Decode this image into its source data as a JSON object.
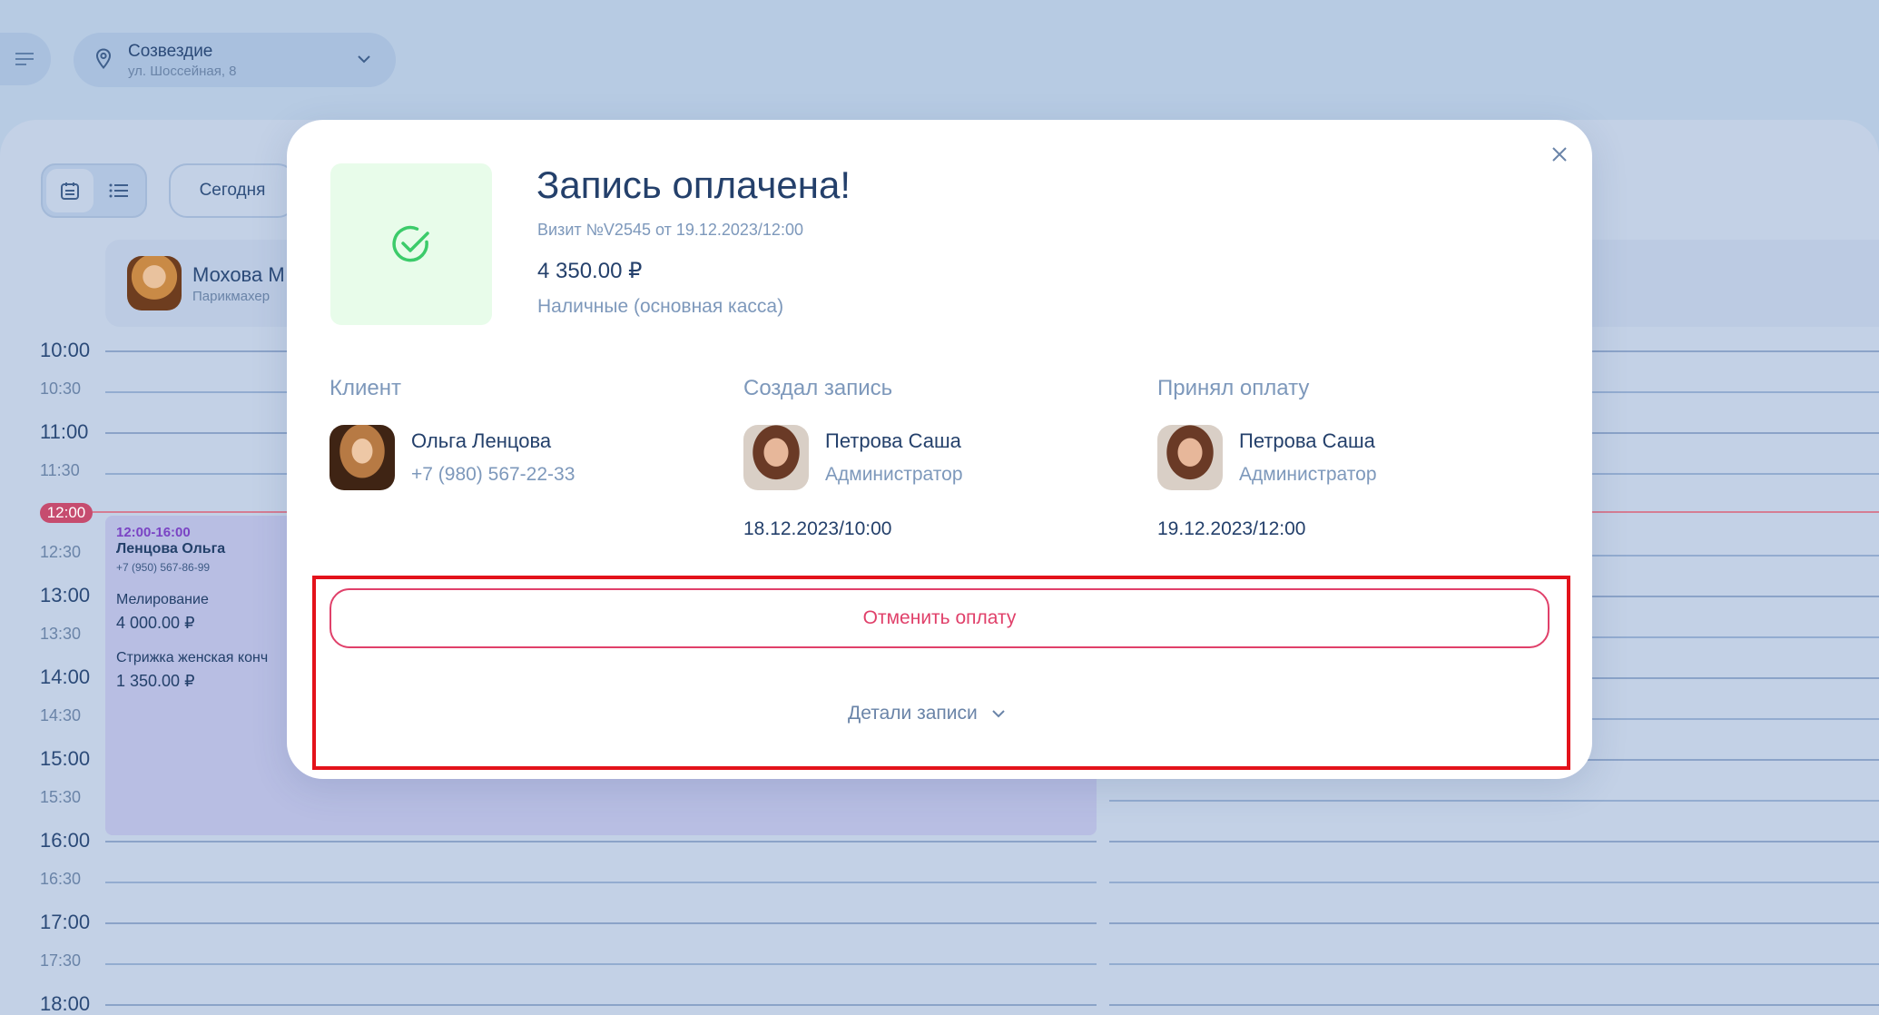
{
  "header": {
    "location_name": "Созвездие",
    "location_address": "ул. Шоссейная, 8"
  },
  "toolbar": {
    "today_label": "Сегодня"
  },
  "staff": {
    "name": "Мохова М",
    "role": "Парикмахер"
  },
  "calendar": {
    "now_label": "12:00",
    "times": [
      {
        "label": "10:00",
        "kind": "h"
      },
      {
        "label": "10:30",
        "kind": "m"
      },
      {
        "label": "11:00",
        "kind": "h"
      },
      {
        "label": "11:30",
        "kind": "m"
      },
      {
        "label": "12:30",
        "kind": "m"
      },
      {
        "label": "13:00",
        "kind": "h"
      },
      {
        "label": "13:30",
        "kind": "m"
      },
      {
        "label": "14:00",
        "kind": "h"
      },
      {
        "label": "14:30",
        "kind": "m"
      },
      {
        "label": "15:00",
        "kind": "h"
      },
      {
        "label": "15:30",
        "kind": "m"
      },
      {
        "label": "16:00",
        "kind": "h"
      },
      {
        "label": "16:30",
        "kind": "m"
      },
      {
        "label": "17:00",
        "kind": "h"
      },
      {
        "label": "17:30",
        "kind": "m"
      },
      {
        "label": "18:00",
        "kind": "h"
      }
    ],
    "event": {
      "time": "12:00-16:00",
      "client": "Ленцова Ольга",
      "phone": "+7 (950) 567-86-99",
      "service1": "Мелирование",
      "price1": "4 000.00 ₽",
      "service2": "Стрижка женская конч",
      "price2": "1 350.00 ₽"
    }
  },
  "modal": {
    "title": "Запись оплачена!",
    "visit": "Визит №V2545 от 19.12.2023/12:00",
    "amount": "4 350.00 ₽",
    "payment_method": "Наличные (основная касса)",
    "client": {
      "heading": "Клиент",
      "name": "Ольга Ленцова",
      "phone": "+7 (980) 567-22-33"
    },
    "created_by": {
      "heading": "Создал запись",
      "name": "Петрова Саша",
      "role": "Администратор",
      "date": "18.12.2023/10:00"
    },
    "accepted_by": {
      "heading": "Принял оплату",
      "name": "Петрова Саша",
      "role": "Администратор",
      "date": "19.12.2023/12:00"
    },
    "cancel_label": "Отменить оплату",
    "details_label": "Детали записи"
  },
  "colors": {
    "accent_danger": "#e0406a",
    "success": "#3ccb6a",
    "highlight": "#e3121b"
  }
}
